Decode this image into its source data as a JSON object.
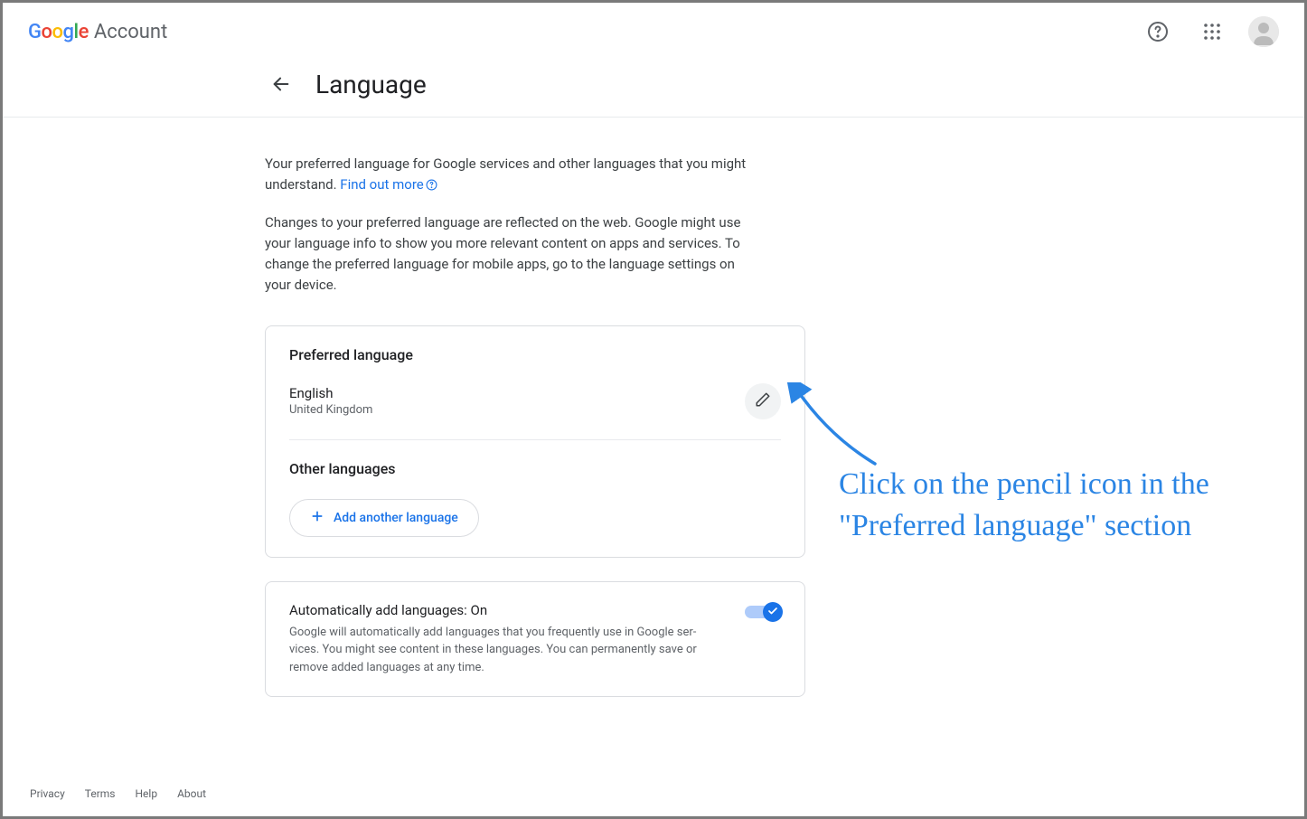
{
  "header": {
    "account_label": "Account"
  },
  "page": {
    "title": "Language",
    "desc1_before": "Your preferred language for Google services and other languages that you might understand. ",
    "find_out_more": "Find out more",
    "desc2": "Changes to your preferred language are reflected on the web. Google might use your language info to show you more relevant content on apps and ser­vices. To change the preferred language for mobile apps, go to the lan­guage settings on your device."
  },
  "preferred": {
    "title": "Preferred language",
    "language": "English",
    "region": "United Kingdom"
  },
  "other": {
    "title": "Other languages",
    "add_button": "Add another language"
  },
  "auto": {
    "title": "Automatically add languages: On",
    "desc": "Google will automatically add languages that you frequently use in Google ser­vices. You might see content in these languages. You can permanently save or remove added languages at any time.",
    "state": "on"
  },
  "footer": {
    "privacy": "Privacy",
    "terms": "Terms",
    "help": "Help",
    "about": "About"
  },
  "annotation": {
    "text": "Click on the pencil icon in the \"Preferred language\" section"
  }
}
